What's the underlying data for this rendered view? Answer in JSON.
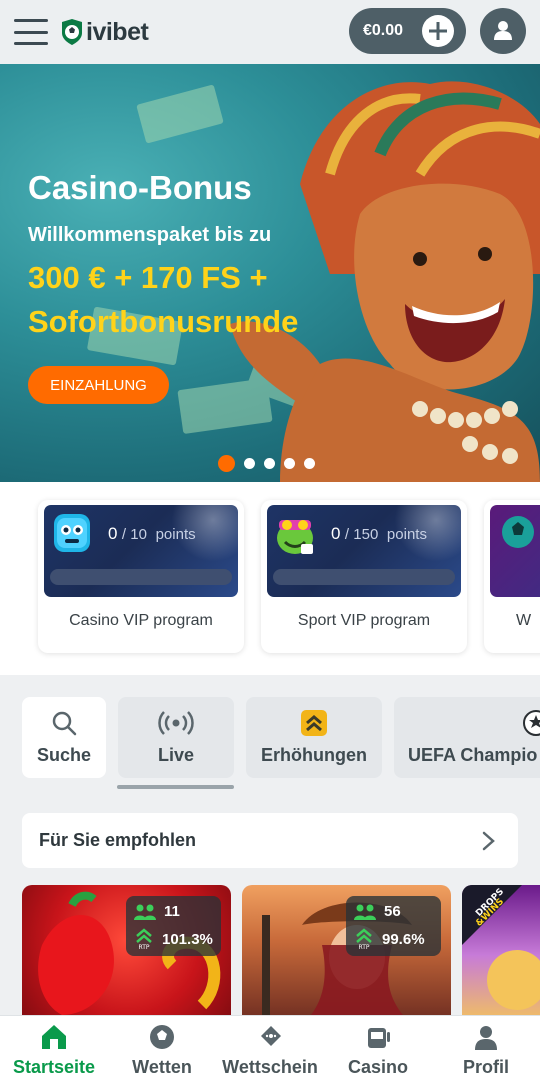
{
  "header": {
    "logo_text": "ivibet",
    "balance": "€0.00"
  },
  "hero": {
    "title": "Casino-Bonus",
    "subtitle": "Willkommenspaket bis zu",
    "amount": "300 € + 170 FS + Sofortbonusrunde",
    "cta": "EINZAHLUNG",
    "slides_total": 5,
    "active_slide": 1
  },
  "vip": [
    {
      "points": "0",
      "max": "10",
      "unit": "points",
      "label": "Casino VIP program",
      "progress": 0
    },
    {
      "points": "0",
      "max": "150",
      "unit": "points",
      "label": "Sport VIP program",
      "progress": 0
    },
    {
      "label": "W"
    }
  ],
  "quick_tiles": {
    "search": "Suche",
    "live": "Live",
    "boosts": "Erhöhungen",
    "uefa": "UEFA Champio"
  },
  "recommended": {
    "title": "Für Sie empfohlen"
  },
  "games": [
    {
      "players": "11",
      "rtp": "101.3%"
    },
    {
      "players": "56",
      "rtp": "99.6%"
    },
    {
      "badge": "DROPS & WINS"
    }
  ],
  "bottom_nav": {
    "home": "Startseite",
    "bets": "Wetten",
    "betslip": "Wettschein",
    "casino": "Casino",
    "profile": "Profil"
  },
  "colors": {
    "accent": "#ff6b00",
    "brand_green": "#0a9a4b",
    "bonus_yellow": "#ffd31a",
    "header_dark": "#4e5f67"
  }
}
